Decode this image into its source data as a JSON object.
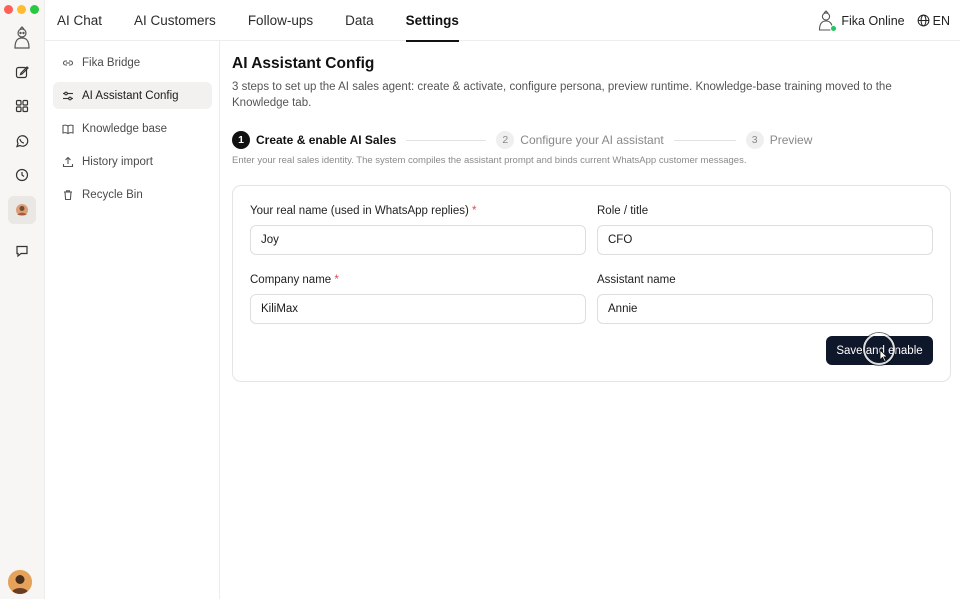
{
  "window": {
    "traffic_lights": [
      "close",
      "minimize",
      "maximize"
    ]
  },
  "rail": {
    "items": [
      {
        "icon": "edit-icon"
      },
      {
        "icon": "grid-icon"
      },
      {
        "icon": "whatsapp-icon"
      },
      {
        "icon": "clock-icon"
      },
      {
        "icon": "profile-icon",
        "active": true
      },
      {
        "icon": "chat-icon"
      }
    ]
  },
  "nav": {
    "tabs": [
      {
        "label": "AI Chat"
      },
      {
        "label": "AI Customers"
      },
      {
        "label": "Follow-ups"
      },
      {
        "label": "Data"
      },
      {
        "label": "Settings",
        "active": true
      }
    ]
  },
  "header": {
    "status_label": "Fika Online",
    "status_color": "#22c55e",
    "language": "EN"
  },
  "sidebar": {
    "items": [
      {
        "label": "Fika Bridge",
        "icon": "link-icon"
      },
      {
        "label": "AI Assistant Config",
        "icon": "sliders-icon",
        "active": true
      },
      {
        "label": "Knowledge base",
        "icon": "book-icon"
      },
      {
        "label": "History import",
        "icon": "upload-icon"
      },
      {
        "label": "Recycle Bin",
        "icon": "trash-icon"
      }
    ]
  },
  "main": {
    "title": "AI Assistant Config",
    "description": "3  steps to set up the AI sales agent: create & activate, configure persona, preview runtime. Knowledge-base training moved to the Knowledge tab.",
    "steps": [
      {
        "num": "1",
        "label": "Create & enable AI Sales",
        "active": true
      },
      {
        "num": "2",
        "label": "Configure your AI assistant"
      },
      {
        "num": "3",
        "label": "Preview"
      }
    ],
    "hint": "Enter your real sales identity. The system compiles the assistant prompt and binds current WhatsApp customer messages.",
    "form": {
      "real_name": {
        "label": "Your real name (used in WhatsApp replies)",
        "required": "*",
        "value": "Joy"
      },
      "role": {
        "label": "Role / title",
        "value": "CFO"
      },
      "company": {
        "label": "Company name",
        "required": "*",
        "value": "KiliMax"
      },
      "assistant_name": {
        "label": "Assistant name",
        "value": "Annie"
      },
      "submit_label": "Save and enable"
    }
  },
  "colors": {
    "accent": "#0f172a",
    "required": "#e5484d"
  }
}
